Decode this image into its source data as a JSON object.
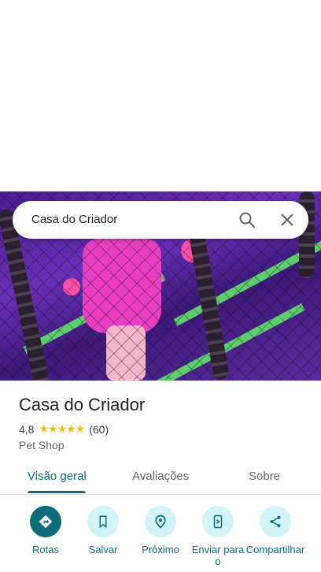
{
  "search": {
    "query": "Casa do Criador"
  },
  "place": {
    "name": "Casa do Criador",
    "rating": "4,8",
    "stars": "★★★★★",
    "review_count": "(60)",
    "category": "Pet Shop"
  },
  "tabs": [
    {
      "label": "Visão geral"
    },
    {
      "label": "Avaliações"
    },
    {
      "label": "Sobre"
    }
  ],
  "actions": [
    {
      "label": "Rotas",
      "icon": "directions-icon"
    },
    {
      "label": "Salvar",
      "icon": "bookmark-icon"
    },
    {
      "label": "Próximo",
      "icon": "nearby-icon"
    },
    {
      "label": "Enviar para o",
      "icon": "send-to-phone-icon"
    },
    {
      "label": "Compartilhar",
      "icon": "share-icon"
    }
  ],
  "colors": {
    "accent": "#0b6b78",
    "accent_light": "#d2f3f7",
    "star": "#fbbc04"
  }
}
